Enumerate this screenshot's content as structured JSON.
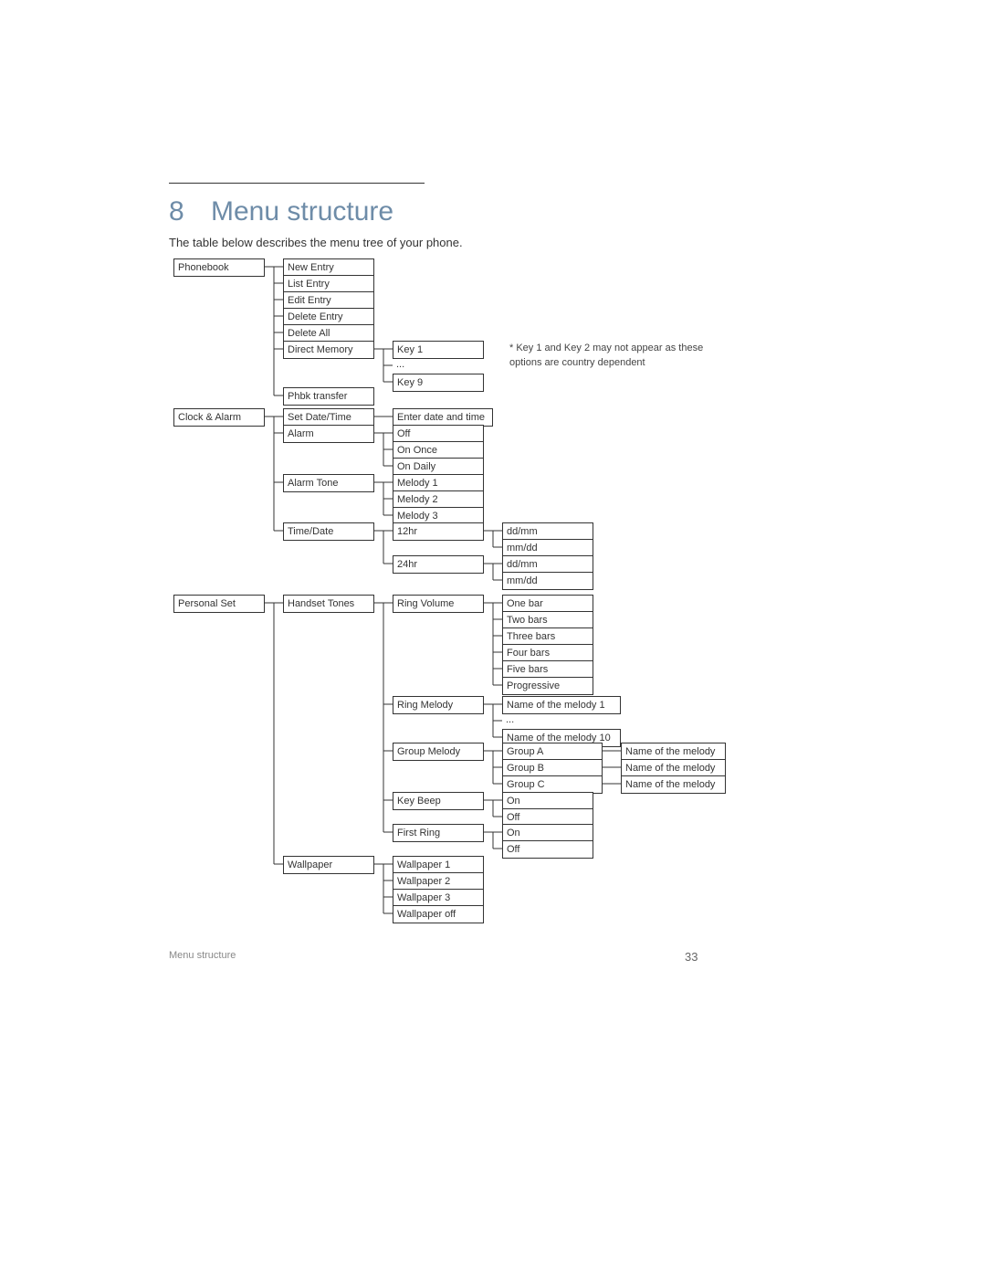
{
  "chapter_number": "8",
  "chapter_title": "Menu structure",
  "subtitle": "The table below describes the menu tree of your phone.",
  "footnote": "* Key 1 and Key 2 may not appear as these options are country dependent",
  "footer_section": "Menu structure",
  "page_number": "33",
  "menu": {
    "phonebook": {
      "label": "Phonebook",
      "items": {
        "new_entry": "New Entry",
        "list_entry": "List Entry",
        "edit_entry": "Edit Entry",
        "delete_entry": "Delete Entry",
        "delete_all": "Delete All",
        "direct_memory": {
          "label": "Direct Memory",
          "items": {
            "key1": "Key 1",
            "ellipsis": "...",
            "key9": "Key 9"
          }
        },
        "phbk_transfer": "Phbk transfer"
      }
    },
    "clock_alarm": {
      "label": "Clock & Alarm",
      "items": {
        "set_datetime": {
          "label": "Set Date/Time",
          "items": {
            "enter": "Enter date and time"
          }
        },
        "alarm": {
          "label": "Alarm",
          "items": {
            "off": "Off",
            "on_once": "On Once",
            "on_daily": "On Daily"
          }
        },
        "alarm_tone": {
          "label": "Alarm Tone",
          "items": {
            "m1": "Melody 1",
            "m2": "Melody 2",
            "m3": "Melody 3"
          }
        },
        "time_date": {
          "label": "Time/Date",
          "items": {
            "h12": {
              "label": "12hr",
              "items": {
                "ddmm": "dd/mm",
                "mmdd": "mm/dd"
              }
            },
            "h24": {
              "label": "24hr",
              "items": {
                "ddmm": "dd/mm",
                "mmdd": "mm/dd"
              }
            }
          }
        }
      }
    },
    "personal_set": {
      "label": "Personal Set",
      "items": {
        "handset_tones": {
          "label": "Handset Tones",
          "items": {
            "ring_volume": {
              "label": "Ring Volume",
              "items": {
                "one": "One bar",
                "two": "Two bars",
                "three": "Three bars",
                "four": "Four bars",
                "five": "Five bars",
                "prog": "Progressive"
              }
            },
            "ring_melody": {
              "label": "Ring Melody",
              "items": {
                "n1": "Name of the melody 1",
                "ellipsis": "...",
                "n10": "Name of the melody 10"
              }
            },
            "group_melody": {
              "label": "Group Melody",
              "items": {
                "a": {
                  "label": "Group A",
                  "value": "Name of the melody"
                },
                "b": {
                  "label": "Group B",
                  "value": "Name of the melody"
                },
                "c": {
                  "label": "Group C",
                  "value": "Name of the melody"
                }
              }
            },
            "key_beep": {
              "label": "Key Beep",
              "items": {
                "on": "On",
                "off": "Off"
              }
            },
            "first_ring": {
              "label": "First Ring",
              "items": {
                "on": "On",
                "off": "Off"
              }
            }
          }
        },
        "wallpaper": {
          "label": "Wallpaper",
          "items": {
            "w1": "Wallpaper 1",
            "w2": "Wallpaper 2",
            "w3": "Wallpaper 3",
            "woff": "Wallpaper off"
          }
        }
      }
    }
  }
}
